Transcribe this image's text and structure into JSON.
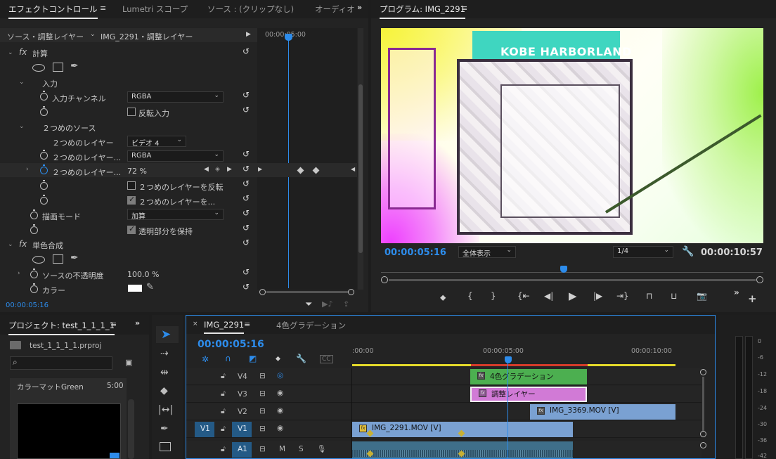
{
  "effect_controls": {
    "tabs": [
      {
        "label": "エフェクトコントロール",
        "active": true
      },
      {
        "label": "Lumetri スコープ"
      },
      {
        "label": "ソース : (クリップなし)"
      },
      {
        "label": "オーディオ"
      }
    ],
    "source_label": "ソース・調整レイヤー",
    "sequence_label": "IMG_2291・調整レイヤー",
    "timecode_ruler": "00:00:05:00",
    "effect1_name": "計算",
    "input_section": "入力",
    "input_channel_label": "入力チャンネル",
    "input_channel_value": "RGBA",
    "invert_input_label": "反転入力",
    "second_source_section": "２つめのソース",
    "second_layer_label": "２つめのレイヤー",
    "second_layer_value": "ビデオ 4",
    "second_layer_channel_label": "２つめのレイヤー...",
    "second_layer_channel_value": "RGBA",
    "second_layer_opacity_label": "２つめのレイヤー...",
    "second_layer_opacity_value": "72 %",
    "invert_second_label": "２つめのレイヤーを反転",
    "stretch_second_label": "２つめのレイヤーを...",
    "blend_mode_label": "描画モード",
    "blend_mode_value": "加算",
    "preserve_transparency_label": "透明部分を保持",
    "effect2_name": "単色合成",
    "source_opacity_label": "ソースの不透明度",
    "source_opacity_value": "100.0 %",
    "color_label": "カラー",
    "color_value": "#ffffff",
    "timecode": "00:00:05:16"
  },
  "program": {
    "title": "プログラム: IMG_2291",
    "sign_text": "KOBE HARBORLAND",
    "timecode": "00:00:05:16",
    "zoom_value": "全体表示",
    "resolution_value": "1/4",
    "duration": "00:00:10:57"
  },
  "project": {
    "title": "プロジェクト: test_1_1_1_1",
    "file": "test_1_1_1_1.prproj",
    "search_placeholder": "",
    "item_name": "カラーマットGreen",
    "item_duration": "5:00"
  },
  "timeline": {
    "tabs": [
      {
        "label": "IMG_2291",
        "active": true
      },
      {
        "label": "4色グラデーション"
      }
    ],
    "timecode": "00:00:05:16",
    "ruler": [
      ":00:00",
      "00:00:05:00",
      "00:00:10:00"
    ],
    "tracks": {
      "v4": "V4",
      "v3": "V3",
      "v2": "V2",
      "v1": "V1",
      "a1": "A1",
      "src_v1": "V1",
      "m": "M",
      "s": "S"
    },
    "clips": {
      "gradient": "4色グラデーション",
      "adjustment": "調整レイヤー",
      "img3369": "IMG_3369.MOV [V]",
      "img2291": "IMG_2291.MOV [V]"
    },
    "colors": {
      "gradient": "#4caf50",
      "adjustment": "#d17ad6",
      "video": "#7aa1d2",
      "audio": "#3f6f8a"
    }
  },
  "meter": {
    "labels": [
      "0",
      "-6",
      "-12",
      "-18",
      "-24",
      "-30",
      "-36",
      "-42"
    ]
  }
}
